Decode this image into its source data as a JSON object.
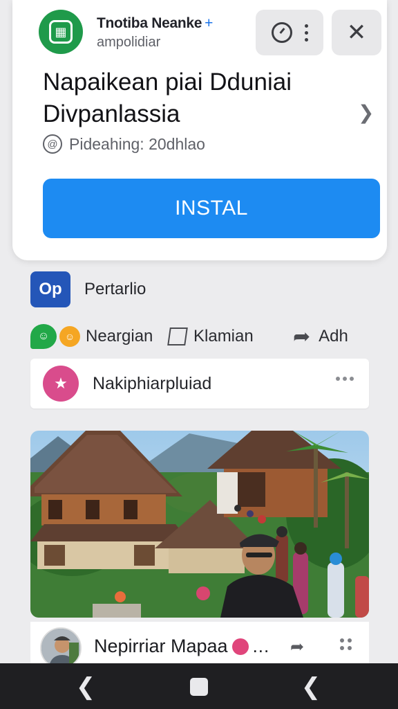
{
  "ad": {
    "app_name": "Tnotiba Neanke",
    "app_name_plus": "+",
    "app_subtitle": "ampolidiar",
    "title": "Napaikean piai Dduniai Divpanlassia",
    "meta": "Pideahing: 20dhlao",
    "install_label": "INSTAL"
  },
  "page": {
    "logo_text": "Op",
    "name": "Pertarlio"
  },
  "actions": {
    "like_label": "Neargian",
    "comment_label": "Klamian",
    "share_label": "Adh"
  },
  "notification": {
    "text": "Nakiphiarpluiad"
  },
  "post": {
    "name": "Nepirriar Mapaa",
    "ellipsis": "..."
  },
  "icons": {
    "app": "app-logo-icon",
    "timer": "timer-icon",
    "more": "more-vertical-icon",
    "close": "close-icon",
    "chevron": "chevron-right-icon",
    "meta": "info-icon",
    "like": "reaction-icon",
    "comment": "comment-icon",
    "share": "share-icon",
    "notification": "star-icon",
    "back": "back-icon",
    "home": "home-icon",
    "recent": "recent-icon"
  },
  "colors": {
    "install": "#1d8bf2",
    "app_icon": "#1f9a4a",
    "page_logo": "#2456b8",
    "notification": "#d94c8c"
  }
}
